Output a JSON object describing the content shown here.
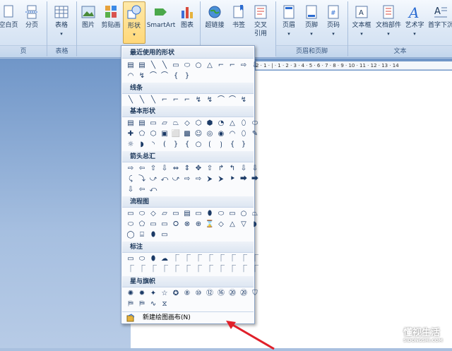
{
  "ribbon": {
    "buttons": [
      {
        "name": "blank-page",
        "label": "空白页",
        "icon": "blank-page-icon"
      },
      {
        "name": "page-break",
        "label": "分页",
        "icon": "page-break-icon"
      },
      {
        "name": "table",
        "label": "表格",
        "icon": "table-icon"
      },
      {
        "name": "picture",
        "label": "图片",
        "icon": "picture-icon"
      },
      {
        "name": "clip-art",
        "label": "剪贴画",
        "icon": "clip-art-icon"
      },
      {
        "name": "shapes",
        "label": "形状",
        "icon": "shapes-icon"
      },
      {
        "name": "smartart",
        "label": "SmartArt",
        "icon": "smartart-icon"
      },
      {
        "name": "chart",
        "label": "图表",
        "icon": "chart-icon"
      },
      {
        "name": "hyperlink",
        "label": "超链接",
        "icon": "globe-icon"
      },
      {
        "name": "bookmark",
        "label": "书签",
        "icon": "bookmark-icon"
      },
      {
        "name": "cross-ref",
        "label": "交叉\n引用",
        "icon": "cross-reference-icon"
      },
      {
        "name": "header",
        "label": "页眉",
        "icon": "header-icon"
      },
      {
        "name": "footer",
        "label": "页脚",
        "icon": "footer-icon"
      },
      {
        "name": "page-number",
        "label": "页码",
        "icon": "page-number-icon"
      },
      {
        "name": "text-box",
        "label": "文本框",
        "icon": "text-box-icon"
      },
      {
        "name": "quick-parts",
        "label": "文档部件",
        "icon": "quick-parts-icon"
      },
      {
        "name": "wordart",
        "label": "艺术字",
        "icon": "wordart-icon"
      },
      {
        "name": "drop-cap",
        "label": "首字下沉",
        "icon": "drop-cap-icon"
      }
    ],
    "groups": [
      "页",
      "表格",
      "插图",
      "页眉和页脚",
      "文本"
    ]
  },
  "shapes_menu": {
    "sections": [
      "最近使用的形状",
      "线条",
      "基本形状",
      "箭头总汇",
      "流程图",
      "标注",
      "星与旗帜"
    ],
    "new_canvas": "新建绘图画布(N)",
    "rows": [
      [
        "▤",
        "▤",
        "╲",
        "╲",
        "▭",
        "⬭",
        "○",
        "△",
        "⌐",
        "⌐",
        "⇨",
        "⇩"
      ],
      [
        "◠",
        "↯",
        "⌒",
        "⌒",
        "{",
        "}"
      ],
      [
        "╲",
        "╲",
        "╲",
        "⌐",
        "⌐",
        "⌐",
        "↯",
        "↯",
        "⌒",
        "⌒",
        "↯"
      ],
      [
        "▤",
        "▤",
        "▭",
        "▱",
        "⏢",
        "◇",
        "⬡",
        "⬢",
        "◔",
        "△",
        "⬯",
        "⬭"
      ],
      [
        "✚",
        "⬠",
        "⬡",
        "▣",
        "⬜",
        "▩",
        "☺",
        "◎",
        "◉",
        "◠",
        "⬯",
        "✎"
      ],
      [
        "☼",
        "◗",
        "◝",
        "(",
        "}",
        "{",
        "○",
        "⟮",
        "⟯",
        "{",
        "}"
      ],
      [
        "⇨",
        "⇦",
        "⇧",
        "⇩",
        "⇔",
        "⇕",
        "✥",
        "⇧",
        "↱",
        "↰",
        "⇩",
        "⇩"
      ],
      [
        "⤹",
        "⤵",
        "⤻",
        "⤺",
        "⤻",
        "⇨",
        "⇨",
        "⮞",
        "⮞",
        "⯈",
        "⮕",
        "⮕"
      ],
      [
        "⇩",
        "⇦",
        "⤺"
      ],
      [
        "▭",
        "⬭",
        "◇",
        "▱",
        "▭",
        "▤",
        "▭",
        "⬮",
        "⬭",
        "▭",
        "○",
        "⏢"
      ],
      [
        "⬭",
        "⬠",
        "▭",
        "▭",
        "⭘",
        "⊗",
        "⊕",
        "⌛",
        "◇",
        "△",
        "▽",
        "◗"
      ],
      [
        "◯",
        "⌸",
        "⬮",
        "▭"
      ],
      [
        "▭",
        "⬭",
        "⬮",
        "☁",
        "⎾",
        "⎾",
        "⎾",
        "⎾",
        "⎾",
        "⎾",
        "⎾",
        "⎾"
      ],
      [
        "⎾",
        "⎾",
        "⎾",
        "⎾",
        "⎾",
        "⎾",
        "⎾",
        "⎾",
        "⎾",
        "⎾",
        "⎾",
        "⎾"
      ],
      [
        "✺",
        "✹",
        "✦",
        "☆",
        "✪",
        "⑧",
        "⑩",
        "⑫",
        "⑯",
        "⑳",
        "⑳",
        "⛉"
      ],
      [
        "⛿",
        "⛿",
        "∿",
        "⧖"
      ]
    ]
  },
  "ruler": {
    "ticks": "2 · 1 · | · 1 · 2 · 3 · 4 · 5 · 6 · 7 · 8 · 9 · 10 · 11 · 12 · 13 · 14"
  },
  "watermark": {
    "title": "懂视生活",
    "domain": "SIDONGSHI.COM"
  },
  "colors": {
    "ribbon": "#dbe7f5",
    "selected_button": "#ffd87a",
    "arrow": "#e0202a"
  }
}
